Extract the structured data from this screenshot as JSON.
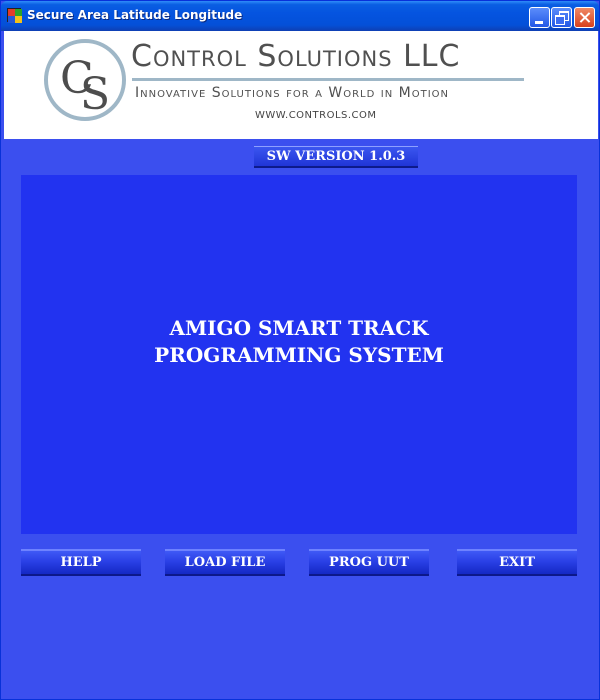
{
  "window": {
    "title": "Secure Area Latitude Longitude",
    "icons": [
      "app-icon",
      "minimize-icon",
      "maximize-icon",
      "close-icon"
    ]
  },
  "banner": {
    "logo_letters": "CS",
    "company_name": "Control Solutions LLC",
    "tagline": "Innovative Solutions for a World in Motion",
    "website": "WWW.CONTROLS.COM"
  },
  "version": {
    "label": "SW VERSION 1.0.3"
  },
  "panel": {
    "title_line1": "AMIGO SMART TRACK",
    "title_line2": "PROGRAMMING SYSTEM"
  },
  "buttons": {
    "help": "HELP",
    "load_file": "LOAD FILE",
    "prog_uut": "PROG UUT",
    "exit": "EXIT"
  },
  "colors": {
    "window_bg": "#3b4fef",
    "panel_bg": "#2233f0",
    "title_bar": "#0554e0"
  }
}
